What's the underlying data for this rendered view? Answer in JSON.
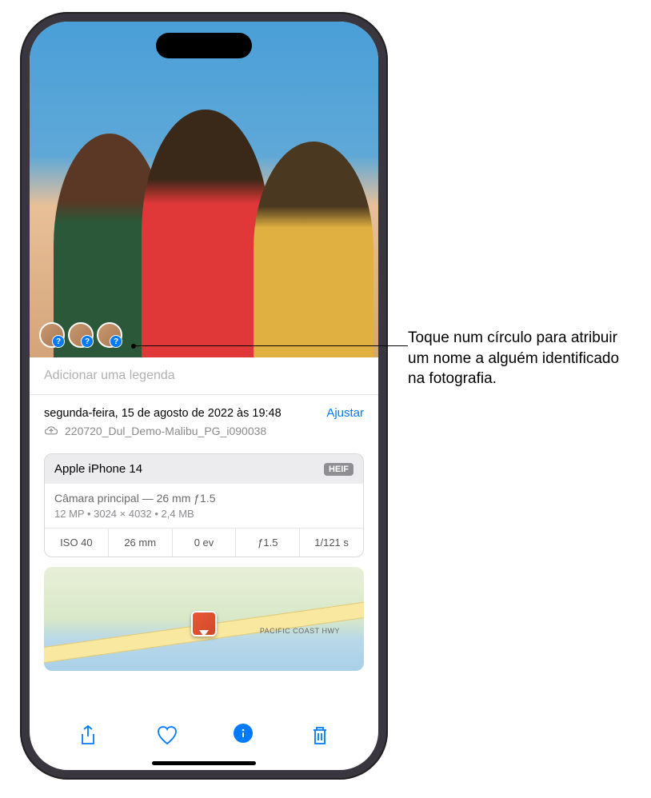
{
  "callout": {
    "text": "Toque num círculo para atribuir um nome a alguém identificado na fotografia."
  },
  "caption": {
    "placeholder": "Adicionar uma legenda"
  },
  "date": {
    "text": "segunda-feira, 15 de agosto de 2022 às 19:48",
    "adjust": "Ajustar"
  },
  "filename": "220720_Dul_Demo-Malibu_PG_i090038",
  "camera": {
    "device": "Apple iPhone 14",
    "format": "HEIF",
    "lens": "Câmara principal — 26 mm ƒ1.5",
    "specs": "12 MP  •  3024 × 4032  •  2,4 MB"
  },
  "exif": {
    "iso": "ISO 40",
    "focal": "26 mm",
    "ev": "0 ev",
    "aperture": "ƒ1.5",
    "shutter": "1/121 s"
  },
  "map": {
    "road": "PACIFIC COAST HWY"
  }
}
